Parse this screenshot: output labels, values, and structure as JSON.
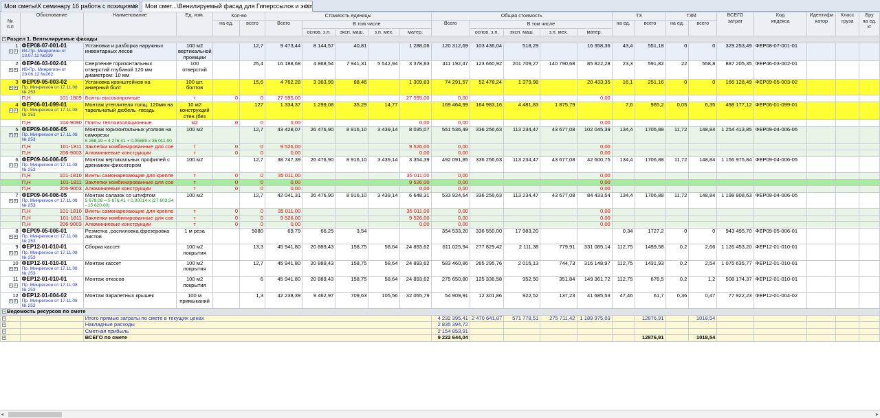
{
  "tabs": [
    {
      "label": "Мои сметы\\К семинару 16 работа с позициями"
    },
    {
      "label": "Мои смет...\\Венилируемый фасад для Гиперссылок и экспертизы"
    }
  ],
  "header": {
    "num": "№",
    "num2": "п.п",
    "obosn": "Обоснование",
    "name": "Наименование",
    "unit": "Ед. изм.",
    "qty": "Кол-во",
    "qty_per": "на ед.",
    "qty_total": "всего",
    "unit_cost": "Стоимость единицы",
    "uc_total": "Всего",
    "uc_incl": "В том числе",
    "uc_osn": "основ. з.п.",
    "uc_eksp": "эксп. маш.",
    "uc_zpmeh": "з.п. мех.",
    "uc_mater": "матер.",
    "total_cost": "Общая стоимость",
    "tc_total": "Всего",
    "tc_incl": "В том числе",
    "tc_osn": "основ. з.п.",
    "tc_eksp": "эксп. маш.",
    "tc_zpmeh": "з.п. мех.",
    "tc_mater": "матер.",
    "tz": "ТЗ",
    "tz_per": "на ед.",
    "tz_total": "всего",
    "tzm": "ТЗМ",
    "tzm_per": "на ед.",
    "tzm_total": "всего",
    "vsego": "ВСЕГО",
    "vsego2": "затрат",
    "kod": "Код",
    "kod2": "индекса",
    "ident": "Идентифи",
    "ident2": "катор",
    "klass": "Класс",
    "klass2": "груза",
    "bru": "Бру",
    "bru2": "на ед.",
    "bru3": "кг"
  },
  "section1": "Раздел 1. Вентилируемые фасады",
  "section2": "Ведомость ресурсов по смете",
  "rows": [
    {
      "kind": "pos",
      "cls": "row-lb",
      "n": "1",
      "code": "ФЕР08-07-001-01",
      "sub": "И4-Пр. Минрегион от 13.07.11 №339",
      "name": "Установка и разборка наружных инвентарных лесов",
      "unit": "100 м2 вертикальной проекции",
      "q1": "",
      "q2": "12,7",
      "uc": "9 473,44",
      "uo": "8 144,57",
      "ue": "40,81",
      "uz": "",
      "um": "1 288,06",
      "tc": "120 312,69",
      "to": "103 436,04",
      "te": "518,29",
      "tz2": "",
      "tm": "16 358,36",
      "tz1": "43,4",
      "tzv": "551,18",
      "tzm1": "0",
      "tzmv": "0",
      "all": "329 253,49",
      "kod": "ФЕР08-07-001-01",
      "fo": ""
    },
    {
      "kind": "pos",
      "cls": "row-w",
      "n": "2",
      "code": "ФЕР46-03-002-01",
      "sub": "И8-Пр. Минрегион от 29.06.12 №262",
      "name": "Сверление горизонтальных отверстий глубиной 120 мм диаметром: 10 мм",
      "unit": "100 отверстий",
      "q1": "",
      "q2": "25,4",
      "uc": "16 188,68",
      "uo": "4 868,54",
      "ue": "7 941,31",
      "uz": "5 542,94",
      "um": "3 378,83",
      "tc": "411 192,47",
      "to": "123 660,92",
      "te": "201 709,27",
      "tz2": "140 790,68",
      "tm": "85 822,28",
      "tz1": "23,3",
      "tzv": "591,82",
      "tzm1": "22",
      "tzmv": "558,8",
      "all": "887 205,35",
      "kod": "ФЕР46-03-002-01",
      "fo": ""
    },
    {
      "kind": "pos",
      "cls": "row-y",
      "n": "3",
      "code": "ФЕР09-05-003-02",
      "sub": "Пр. Минрегион от 17.11.08 № 253",
      "name": "Установка кронштейнов на анкерный болт",
      "unit": "100 шт. болтов",
      "q1": "",
      "q2": "15,6",
      "uc": "4 762,28",
      "uo": "3 363,99",
      "ue": "88,46",
      "uz": "",
      "um": "1 309,83",
      "tc": "74 291,57",
      "to": "52 478,24",
      "te": "1 379,98",
      "tz2": "",
      "tm": "20 433,35",
      "tz1": "16,1",
      "tzv": "251,16",
      "tzm1": "0",
      "tzmv": "0",
      "all": "166 128,49",
      "kod": "ФЕР09-05-003-02",
      "fo": ""
    },
    {
      "kind": "res",
      "cls": "row-w",
      "p": "П,Н",
      "c": "101-1809",
      "name": "Болты высокопрочные",
      "unit": "т",
      "q1": "0",
      "q2": "0",
      "uc": "27 595,00",
      "um": "27 595,00",
      "tc": "0,00",
      "tm": "0,00",
      "hl": "",
      "box": ""
    },
    {
      "kind": "pos",
      "cls": "row-y",
      "n": "4",
      "code": "ФЕР06-01-099-01",
      "sub": "Пр. Минрегион от 17.11.08 № 253",
      "name": "Монтаж утеплителя толщ. 120мм на тарельчатый дюбель -гвоздь",
      "unit": "10 м2 конструкций стен (без",
      "q1": "",
      "q2": "127",
      "uc": "1 334,37",
      "uo": "1 299,08",
      "ue": "35,29",
      "uz": "14,77",
      "um": "",
      "tc": "169 464,99",
      "to": "164 983,16",
      "te": "4 481,83",
      "tz2": "1 875,79",
      "tm": "",
      "tz1": "7,6",
      "tzv": "965,2",
      "tzm1": "0,05",
      "tzmv": "6,35",
      "all": "498 177,12",
      "kod": "ФЕР06-01-099-01",
      "fo": ""
    },
    {
      "kind": "res",
      "cls": "row-w",
      "p": "П,Н",
      "c": "104-9090",
      "name": "Плиты теплоизоляционные",
      "unit": "м2",
      "q1": "0",
      "q2": "0",
      "uc": "0,00",
      "um": "0,00",
      "tc": "0,00",
      "tm": "0,00",
      "hl": "",
      "box": ""
    },
    {
      "kind": "pos",
      "cls": "row-g",
      "n": "5",
      "code": "ФЕР09-04-006-05",
      "sub": "Пр. Минрегион от 17.11.08 № 253",
      "name": "Монтаж горизонтальных уголков на саморезы",
      "formula": "6 268,19 = 4 276,41 + 0,05689 x 35 011,00",
      "unit": "100 м2",
      "q1": "",
      "q2": "12,7",
      "uc": "43 428,07",
      "uo": "26 476,90",
      "ue": "8 916,10",
      "uz": "3 439,14",
      "um": "8 035,07",
      "tc": "551 536,49",
      "to": "336 256,63",
      "te": "113 234,47",
      "tz2": "43 677,08",
      "tm": "102 045,39",
      "tz1": "134,4",
      "tzv": "1706,88",
      "tzm1": "11,72",
      "tzmv": "148,84",
      "all": "1 254 413,85",
      "kod": "ФЕР09-04-006-05",
      "fo": ""
    },
    {
      "kind": "res",
      "cls": "row-g",
      "p": "П,Н",
      "c": "101-1811",
      "name": "Заклепки комбинированные для сое",
      "unit": "т",
      "q1": "0",
      "q2": "0",
      "uc": "9 526,00",
      "um": "9 526,00",
      "tc": "0,00",
      "tm": "0,00",
      "hl": "",
      "box": ""
    },
    {
      "kind": "res",
      "cls": "row-g",
      "p": "П,Н",
      "c": "206-9003",
      "name": "Алюминиевые конструкции",
      "unit": "т",
      "q1": "0",
      "q2": "0",
      "uc": "0,00",
      "um": "0,00",
      "tc": "0,00",
      "tm": "0,00",
      "hl": "",
      "box": ""
    },
    {
      "kind": "pos",
      "cls": "row-w",
      "n": "6",
      "code": "ФЕР09-04-006-05",
      "sub": "Пр. Минрегион от 17.11.08 № 253",
      "name": "Монтаж вертикальных профилей с дренажом-фиксатором",
      "unit": "100 м2",
      "q1": "",
      "q2": "12,7",
      "uc": "38 747,39",
      "uo": "26 476,90",
      "ue": "8 916,10",
      "uz": "3 439,14",
      "um": "3 354,39",
      "tc": "492 091,85",
      "to": "336 256,63",
      "te": "113 234,47",
      "tz2": "43 677,08",
      "tm": "42 600,75",
      "tz1": "134,4",
      "tzv": "1706,88",
      "tzm1": "11,72",
      "tzmv": "148,84",
      "all": "1 156 975,84",
      "kod": "ФЕР09-04-006-05",
      "fo": ""
    },
    {
      "kind": "res",
      "cls": "row-g",
      "p": "П,Н",
      "c": "101-1810",
      "name": "Винты самонарезающие для крепле",
      "unit": "т",
      "q1": "0",
      "q2": "0",
      "uc": "35 011,00",
      "um": "35 011,00",
      "tc": "0,00",
      "tm": "0,00",
      "hl": "",
      "box": "um"
    },
    {
      "kind": "res",
      "cls": "row-g",
      "p": "П,Н",
      "c": "101-1811",
      "name": "Заклепки комбинированные для сое",
      "unit": "т",
      "q1": "0",
      "q2": "0",
      "uc": "0,00",
      "um": "9 526,00",
      "tc": "0,00",
      "tm": "0,00",
      "hl": "1",
      "box": ""
    },
    {
      "kind": "res",
      "cls": "row-g",
      "p": "П,Н",
      "c": "206-9003",
      "name": "Алюминиевые конструкции",
      "unit": "т",
      "q1": "0",
      "q2": "0",
      "uc": "0,00",
      "um": "0,00",
      "tc": "0,00",
      "tm": "0,00",
      "hl": "",
      "box": ""
    },
    {
      "kind": "pos",
      "cls": "row-w",
      "n": "7",
      "code": "ФЕР09-04-006-05",
      "sub": "Пр. Минрегион от 17.11.08 № 253",
      "name": "Монтаж салазок со штифтом",
      "formula": "5 678,08 = 5 676,41 + 0,00014 x (27 603,54 - 15 620,00)",
      "unit": "100 м2",
      "q1": "",
      "q2": "12,7",
      "uc": "42 041,31",
      "uo": "26 476,90",
      "ue": "8 916,10",
      "uz": "3 439,14",
      "um": "6 648,31",
      "tc": "533 924,64",
      "to": "336 256,63",
      "te": "113 234,47",
      "tz2": "43 677,08",
      "tm": "84 433,54",
      "tz1": "134,4",
      "tzv": "1706,88",
      "tzm1": "11,72",
      "tzmv": "148,84",
      "all": "1 198 808,63",
      "kod": "ФЕР09-04-006-05",
      "fo": ""
    },
    {
      "kind": "res",
      "cls": "row-g",
      "p": "П,Н",
      "c": "101-1810",
      "name": "Винты самонарезающие для крепле",
      "unit": "т",
      "q1": "0",
      "q2": "0",
      "uc": "35 011,00",
      "um": "35 011,00",
      "tc": "0,00",
      "tm": "0,00",
      "hl": "",
      "box": ""
    },
    {
      "kind": "res",
      "cls": "row-g",
      "p": "П,Н",
      "c": "101-1811",
      "name": "Заклепки комбинированные для сое",
      "unit": "т",
      "q1": "0",
      "q2": "0",
      "uc": "9 526,00",
      "um": "9 526,00",
      "tc": "0,00",
      "tm": "0,00",
      "hl": "",
      "box": ""
    },
    {
      "kind": "res",
      "cls": "row-g",
      "p": "П,Н",
      "c": "206-9003",
      "name": "Алюминиевые конструкции",
      "unit": "т",
      "q1": "0",
      "q2": "0",
      "uc": "0,00",
      "um": "0,00",
      "tc": "0,00",
      "tm": "0,00",
      "hl": "",
      "box": ""
    },
    {
      "kind": "pos",
      "cls": "row-w",
      "n": "8",
      "code": "ФЕР09-05-006-01",
      "sub": "Пр. Минрегион от 17.11.08 № 253",
      "name": "Резметка ,распиловка,фрезеровка листов",
      "unit": "1 м реза",
      "q1": "",
      "q2": "5080",
      "uc": "69,79",
      "uo": "66,25",
      "ue": "3,54",
      "uz": "",
      "um": "",
      "tc": "354 533,20",
      "to": "336 550,00",
      "te": "17 983,20",
      "tz2": "",
      "tm": "",
      "tz1": "0,34",
      "tzv": "1727,2",
      "tzm1": "0",
      "tzmv": "0",
      "all": "943 495,70",
      "kod": "ФЕР09-05-006-01",
      "fo": ""
    },
    {
      "kind": "pos",
      "cls": "row-w",
      "n": "9",
      "code": "ФЕР12-01-010-01",
      "sub": "Пр. Минрегион от 17.11.08 № 253",
      "name": "Сборка кассет",
      "unit": "100 м2 покрытия",
      "q1": "",
      "q2": "13,3",
      "uc": "45 941,80",
      "uo": "20 889,43",
      "ue": "158,75",
      "uz": "58,64",
      "um": "24 893,62",
      "tc": "611 025,94",
      "to": "277 829,42",
      "te": "2 111,38",
      "tz2": "779,91",
      "tm": "331 085,14",
      "tz1": "112,75",
      "tzv": "1499,58",
      "tzm1": "0,2",
      "tzmv": "2,66",
      "all": "1 126 453,20",
      "kod": "ФЕР12-01-010-01",
      "fo": ""
    },
    {
      "kind": "pos",
      "cls": "row-w",
      "n": "10",
      "code": "ФЕР12-01-010-01",
      "sub": "Пр. Минрегион от 17.11.08 № 253",
      "name": "Монтаж кассет",
      "unit": "100 м2 покрытия",
      "q1": "",
      "q2": "12,7",
      "uc": "45 941,80",
      "uo": "20 889,43",
      "ue": "158,75",
      "uz": "58,64",
      "um": "24 893,62",
      "tc": "583 460,86",
      "to": "265 295,76",
      "te": "2 016,13",
      "tz2": "744,73",
      "tm": "316 148,97",
      "tz1": "112,75",
      "tzv": "1431,93",
      "tzm1": "0,2",
      "tzmv": "2,54",
      "all": "1 075 635,77",
      "kod": "ФЕР12-01-010-01",
      "fo": ""
    },
    {
      "kind": "pos",
      "cls": "row-w",
      "n": "11",
      "code": "ФЕР12-01-010-01",
      "sub": "Пр. Минрегион от 17.11.08 № 253",
      "name": "Монтаж откосов",
      "unit": "100 м2 покрытия",
      "q1": "",
      "q2": "6",
      "uc": "45 941,80",
      "uo": "20 889,43",
      "ue": "158,75",
      "uz": "58,64",
      "um": "24 893,62",
      "tc": "275 650,80",
      "to": "125 336,58",
      "te": "952,50",
      "tz2": "351,84",
      "tm": "149 361,72",
      "tz1": "112,75",
      "tzv": "676,5",
      "tzm1": "0,2",
      "tzmv": "1,2",
      "all": "508 174,37",
      "kod": "ФЕР12-01-010-01",
      "fo": ""
    },
    {
      "kind": "pos",
      "cls": "row-w",
      "n": "12",
      "code": "ФЕР12-01-004-02",
      "sub": "Пр. Минрегион от 17.11.08 № 253",
      "name": "Монтаж парапетных крышек",
      "unit": "100 м примыканий",
      "q1": "",
      "q2": "1,3",
      "uc": "42 238,39",
      "uo": "9 462,97",
      "ue": "709,63",
      "uz": "105,56",
      "um": "32 065,79",
      "tc": "54 909,91",
      "to": "12 301,86",
      "te": "922,52",
      "tz2": "137,23",
      "tm": "41 685,53",
      "tz1": "47,46",
      "tzv": "61,7",
      "tzm1": "0,36",
      "tzmv": "0,47",
      "all": "77 922,23",
      "kod": "ФЕР12-01-004-02",
      "fo": ""
    }
  ],
  "totals": [
    {
      "label": "Итого прямые затраты по смете в текущих ценах",
      "tc": "4 232 395,41",
      "to": "2 470 641,87",
      "te": "571 778,51",
      "tz2": "275 711,42",
      "tm": "1 189 975,03",
      "tzv": "12876,91",
      "tzmv": "1018,54",
      "bold": ""
    },
    {
      "label": "Накладные расходы",
      "tc": "2 835 394,72",
      "to": "",
      "te": "",
      "tz2": "",
      "tm": "",
      "tzv": "",
      "tzmv": "",
      "bold": ""
    },
    {
      "label": "Сметная прибыль",
      "tc": "2 154 853,91",
      "to": "",
      "te": "",
      "tz2": "",
      "tm": "",
      "tzv": "",
      "tzmv": "",
      "bold": ""
    },
    {
      "label": "ВСЕГО по смете",
      "tc": "9 222 644,04",
      "to": "",
      "te": "",
      "tz2": "",
      "tm": "",
      "tzv": "12876,91",
      "tzmv": "1018,54",
      "bold": "1"
    }
  ]
}
